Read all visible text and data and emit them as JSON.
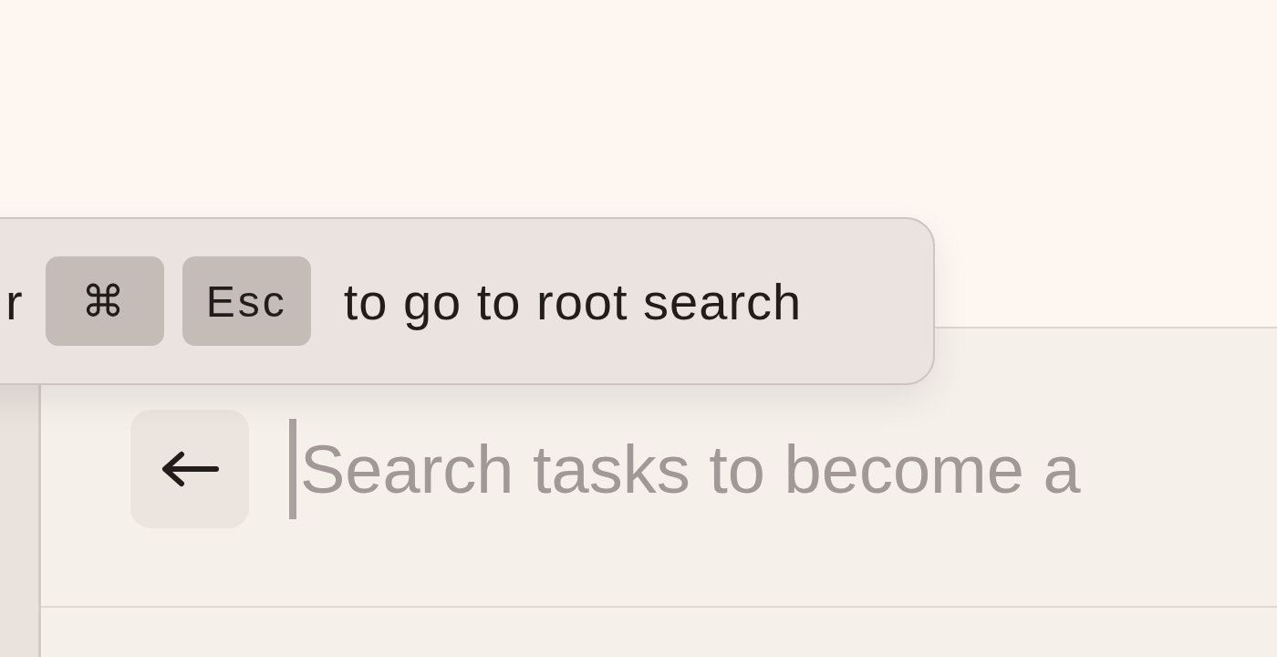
{
  "hint": {
    "leading_text": "r",
    "keys": [
      "⌘",
      "Esc"
    ],
    "text": "to go to root search"
  },
  "search": {
    "placeholder": "Search tasks to become a"
  }
}
